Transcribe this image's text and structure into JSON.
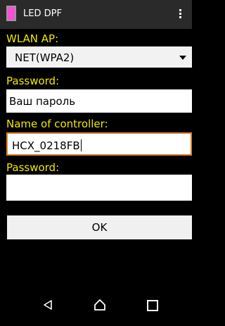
{
  "app": {
    "title": "LED DPF"
  },
  "labels": {
    "wlan_ap": "WLAN AP:",
    "password1": "Password:",
    "name_of_controller": "Name of controller:",
    "password2": "Password:"
  },
  "inputs": {
    "wlan_select_value": "NET(WPA2)",
    "password1_value": "Ваш пароль",
    "controller_name_value": "HCX_0218FB",
    "password2_value": ""
  },
  "buttons": {
    "ok_label": "OK"
  },
  "icons": {
    "app_icon": "led-dpf-app-icon",
    "overflow": "overflow-menu-icon",
    "dropdown": "chevron-down-icon",
    "back": "back-icon",
    "home": "home-icon",
    "recent": "recent-apps-icon"
  },
  "colors": {
    "accent": "#f2e700",
    "app_icon": "#ff4bd8",
    "focus_border": "#d9822b"
  }
}
